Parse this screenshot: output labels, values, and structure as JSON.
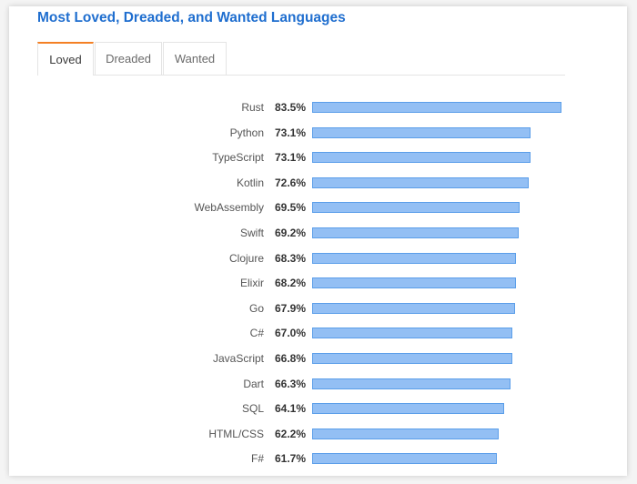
{
  "header": {
    "title": "Most Loved, Dreaded, and Wanted Languages"
  },
  "tabs": [
    {
      "label": "Loved",
      "active": true
    },
    {
      "label": "Dreaded",
      "active": false
    },
    {
      "label": "Wanted",
      "active": false
    }
  ],
  "colors": {
    "title": "#1f6ecf",
    "active_tab_accent": "#f48024",
    "bar_fill": "#93bff4",
    "bar_border": "#5b9ee9"
  },
  "chart_data": {
    "type": "bar",
    "orientation": "horizontal",
    "title": "Most Loved, Dreaded, and Wanted Languages",
    "xlabel": "",
    "ylabel": "",
    "unit": "%",
    "xlim": [
      0,
      83.5
    ],
    "grid": false,
    "categories": [
      "Rust",
      "Python",
      "TypeScript",
      "Kotlin",
      "WebAssembly",
      "Swift",
      "Clojure",
      "Elixir",
      "Go",
      "C#",
      "JavaScript",
      "Dart",
      "SQL",
      "HTML/CSS",
      "F#"
    ],
    "values": [
      83.5,
      73.1,
      73.1,
      72.6,
      69.5,
      69.2,
      68.3,
      68.2,
      67.9,
      67.0,
      66.8,
      66.3,
      64.1,
      62.2,
      61.7
    ],
    "labels": [
      "83.5%",
      "73.1%",
      "73.1%",
      "72.6%",
      "69.5%",
      "69.2%",
      "68.3%",
      "68.2%",
      "67.9%",
      "67.0%",
      "66.8%",
      "66.3%",
      "64.1%",
      "62.2%",
      "61.7%"
    ]
  }
}
